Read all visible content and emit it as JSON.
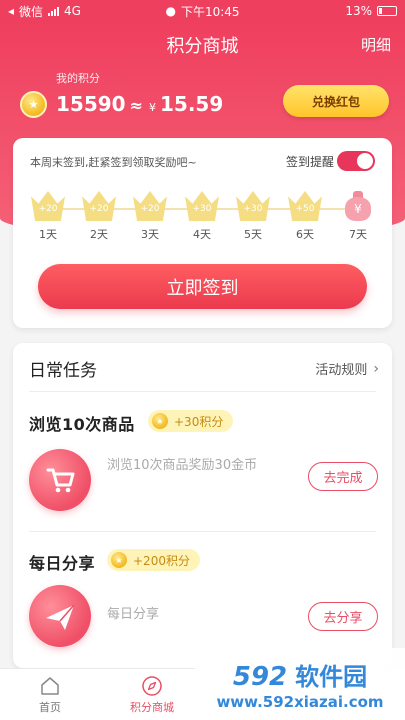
{
  "status": {
    "carrier": "微信",
    "network": "4G",
    "time": "下午10:45",
    "battery": "13%"
  },
  "header": {
    "title": "积分商城",
    "detail_label": "明细",
    "my_points_label": "我的积分",
    "points": "15590",
    "approx": "≈",
    "currency": "¥",
    "cash_value": "15.59",
    "exchange_label": "兑换红包"
  },
  "signin": {
    "tip": "本周末签到,赶紧签到领取奖励吧~",
    "remind_label": "签到提醒",
    "remind_on": true,
    "days": [
      {
        "reward": "+20",
        "label": "1天"
      },
      {
        "reward": "+20",
        "label": "2天"
      },
      {
        "reward": "+20",
        "label": "3天"
      },
      {
        "reward": "+30",
        "label": "4天"
      },
      {
        "reward": "+30",
        "label": "5天"
      },
      {
        "reward": "+50",
        "label": "6天"
      }
    ],
    "final_day": {
      "symbol": "¥",
      "label": "7天"
    },
    "button_label": "立即签到"
  },
  "tasks": {
    "title": "日常任务",
    "rules_label": "活动规则",
    "items": [
      {
        "name": "浏览10次商品",
        "reward": "+30积分",
        "description": "浏览10次商品奖励30金币",
        "button_label": "去完成",
        "icon": "shopping-cart-icon"
      },
      {
        "name": "每日分享",
        "reward": "+200积分",
        "description": "每日分享",
        "button_label": "去分享",
        "icon": "paper-plane-icon"
      }
    ]
  },
  "tabbar": {
    "items": [
      {
        "label": "首页",
        "icon": "home-icon"
      },
      {
        "label": "积分商城",
        "icon": "compass-icon"
      }
    ]
  },
  "watermark": {
    "number": "592",
    "word": "软件园",
    "url": "www.592xiazai.com"
  },
  "colors": {
    "primary": "#ef3f5e",
    "accent_gold": "#ffc52a",
    "reward_text": "#c68a12"
  }
}
